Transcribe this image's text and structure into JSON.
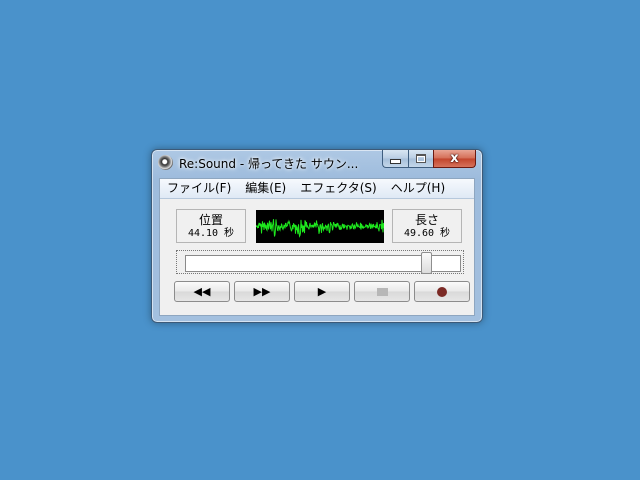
{
  "window": {
    "title": "Re:Sound - 帰ってきた サウン...",
    "close_label": "x"
  },
  "menu": [
    {
      "label": "ファイル(F)"
    },
    {
      "label": "編集(E)"
    },
    {
      "label": "エフェクタ(S)"
    },
    {
      "label": "ヘルプ(H)"
    }
  ],
  "position": {
    "label": "位置",
    "value": "44.10 秒"
  },
  "length": {
    "label": "長さ",
    "value": "49.60 秒"
  },
  "waveform": {
    "color": "#1ee81e",
    "background": "#000000"
  },
  "seek": {
    "progress": 0.889
  },
  "controls": {
    "rewind": "◀◀",
    "fast_forward": "▶▶",
    "play": "▶",
    "stop_enabled": false,
    "record_color": "#7b2a25"
  },
  "colors": {
    "desktop": "#4a92cb"
  }
}
